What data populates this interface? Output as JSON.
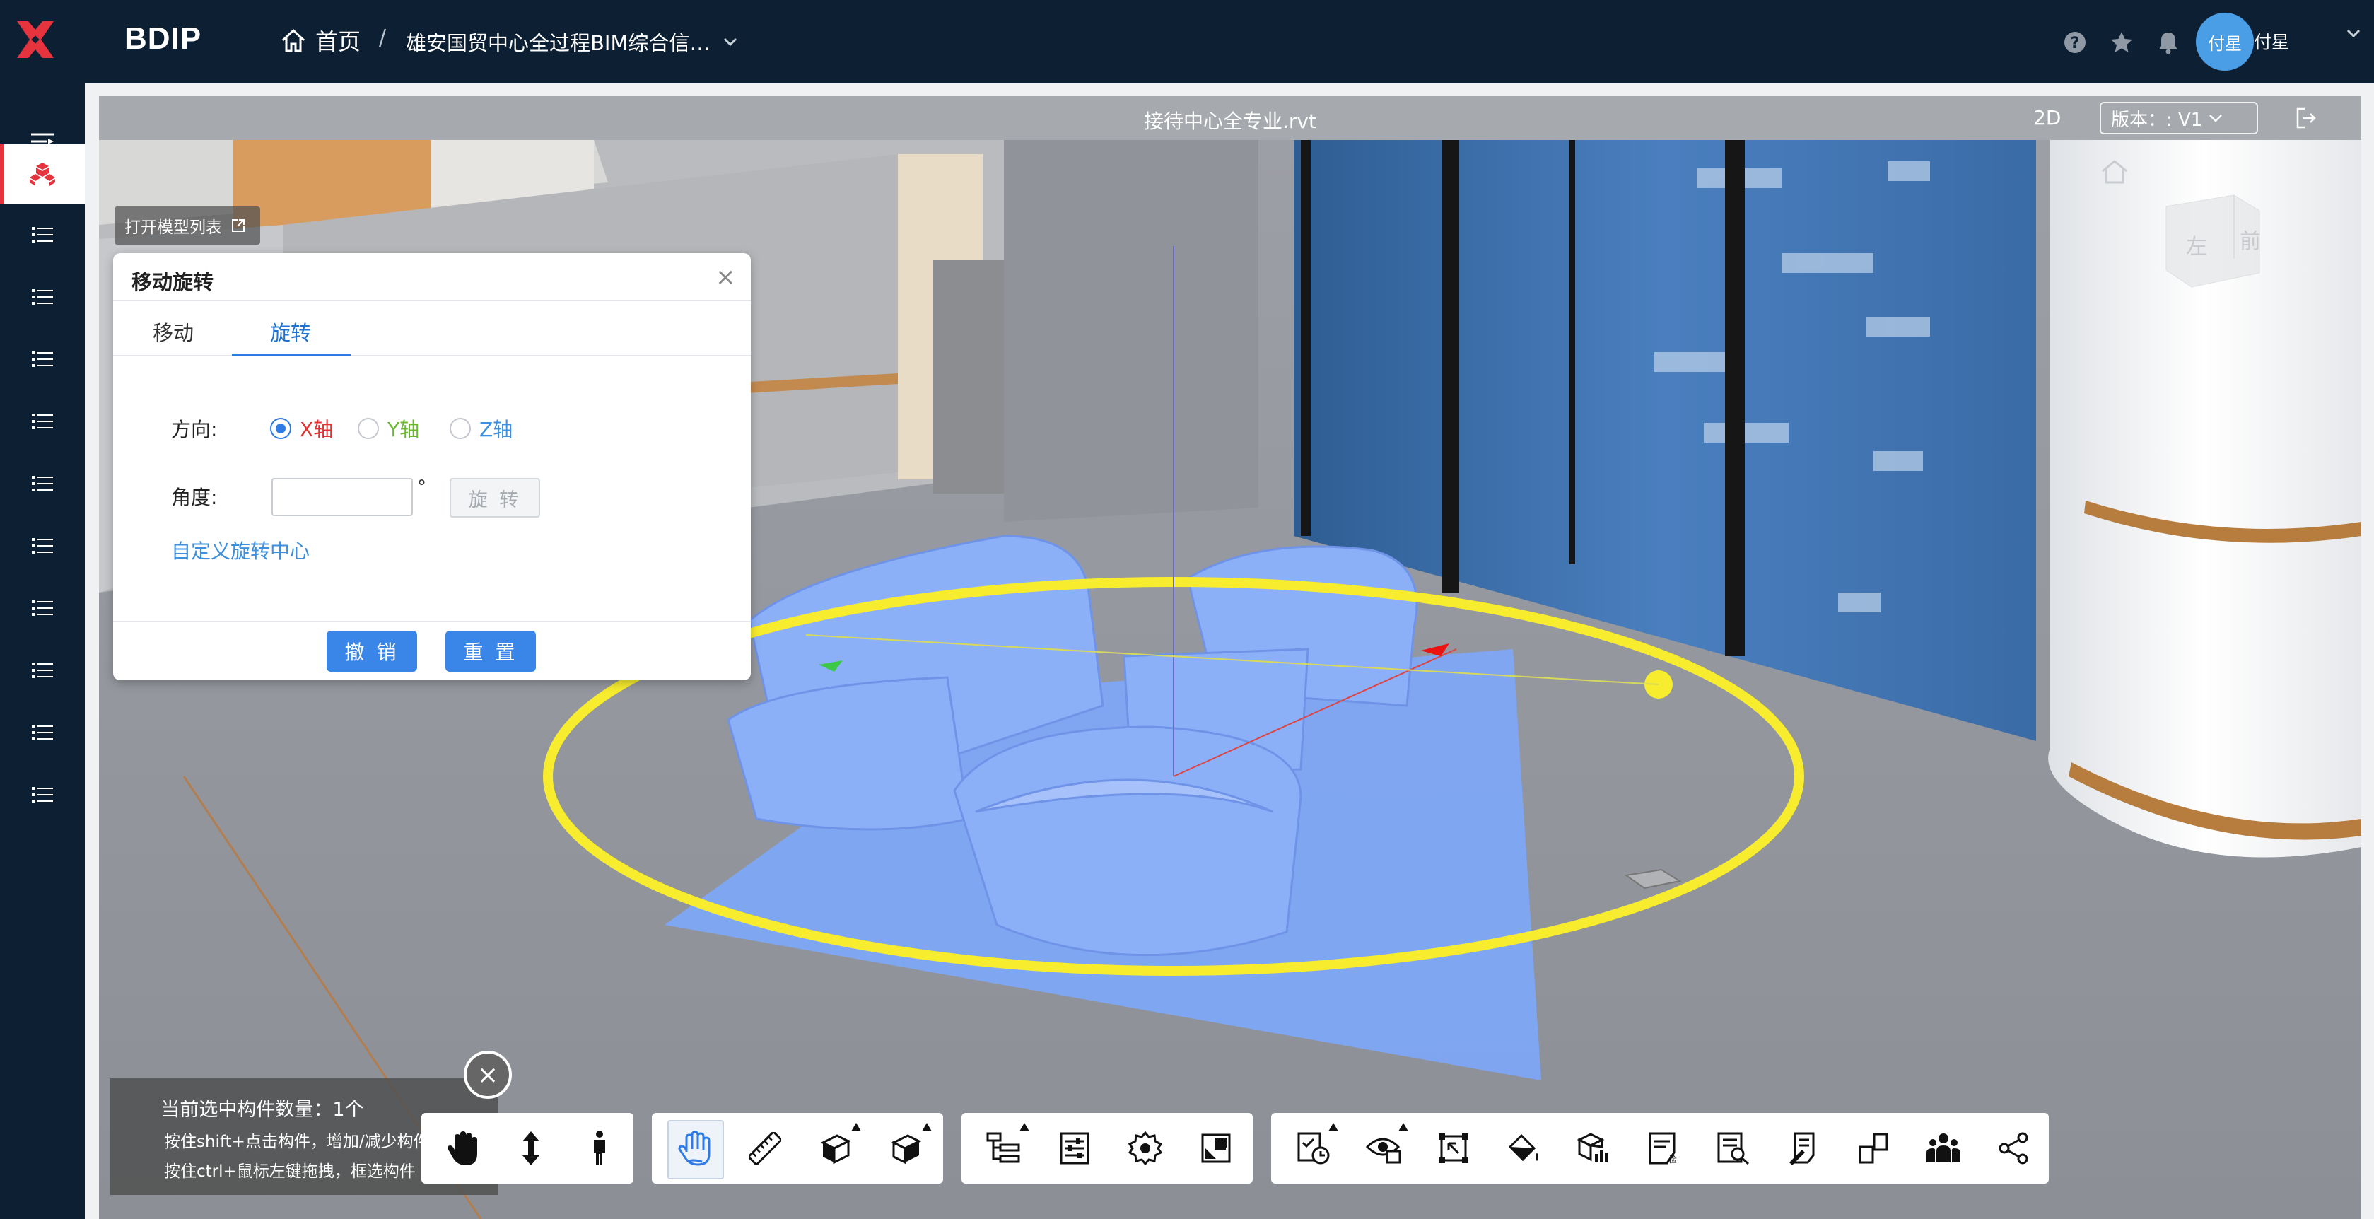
{
  "app": {
    "brand": "BDIP"
  },
  "breadcrumb": {
    "home_label": "首页",
    "separator": "/",
    "project": "雄安国贸中心全过程BIM综合信…"
  },
  "user": {
    "avatar_text": "付星",
    "name": "付星"
  },
  "viewer": {
    "file_title": "接待中心全专业.rvt",
    "mode_label": "2D",
    "version_label": "版本：: V1"
  },
  "viewcube": {
    "face_left": "左",
    "face_front": "前"
  },
  "open_model_list": "打开模型列表",
  "dialog": {
    "title": "移动旋转",
    "tabs": [
      {
        "label": "移动"
      },
      {
        "label": "旋转"
      }
    ],
    "direction_label": "方向:",
    "axes": [
      {
        "label": "X轴",
        "color": "#e03232",
        "checked": true
      },
      {
        "label": "Y轴",
        "color": "#69b82e",
        "checked": false
      },
      {
        "label": "Z轴",
        "color": "#3d8fe0",
        "checked": false
      }
    ],
    "angle_label": "角度:",
    "angle_value": "",
    "degree_symbol": "°",
    "rotate_button": "旋 转",
    "custom_center_link": "自定义旋转中心",
    "undo_button": "撤 销",
    "reset_button": "重 置"
  },
  "selection_info": {
    "count_text": "当前选中构件数量：1个",
    "hint1": "按住shift+点击构件，增加/减少构件",
    "hint2": "按住ctrl+鼠标左键拖拽，框选构件"
  },
  "toolbar": {
    "group1": [
      "pan-hand-icon",
      "vertical-move-icon",
      "walk-person-icon"
    ],
    "group2": [
      "select-hand-icon",
      "ruler-icon",
      "section-box-icon",
      "explode-cube-icon"
    ],
    "group3": [
      "model-tree-icon",
      "properties-icon",
      "settings-gear-icon",
      "fullscreen-icon"
    ],
    "group4": [
      "progress-check-icon",
      "view-manage-icon",
      "zoom-extent-icon",
      "paint-bucket-icon",
      "model-stats-icon",
      "review-doc-icon",
      "search-list-icon",
      "annotation-icon",
      "component-link-icon",
      "collaborators-icon",
      "share-icon"
    ]
  },
  "colors": {
    "topbar": "#0d1f33",
    "accent_blue": "#3a86e8",
    "active_red": "#e5343d",
    "ring_yellow": "#f7ec2e",
    "furniture_blue": "#7ea6f5"
  }
}
